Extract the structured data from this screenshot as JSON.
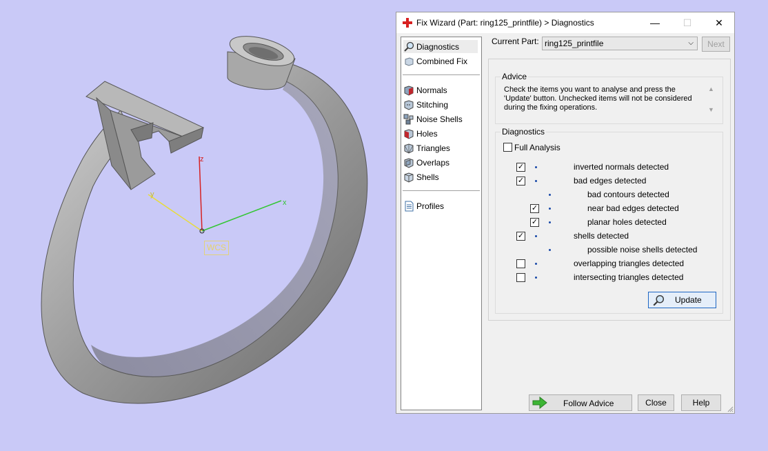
{
  "viewport": {
    "axes": {
      "z": "z",
      "y": "y",
      "x": "x",
      "wcs": "WCS"
    }
  },
  "dialog": {
    "title": "Fix Wizard (Part: ring125_printfile) > Diagnostics",
    "controls": {
      "minimize": "—",
      "maximize": "☐",
      "close": "✕"
    },
    "nav": {
      "top": [
        {
          "label": "Diagnostics",
          "icon": "magnifier-icon",
          "active": true
        },
        {
          "label": "Combined Fix",
          "icon": "cube-icon"
        }
      ],
      "middle": [
        {
          "label": "Normals",
          "icon": "normals-icon"
        },
        {
          "label": "Stitching",
          "icon": "stitching-icon"
        },
        {
          "label": "Noise Shells",
          "icon": "noise-shells-icon"
        },
        {
          "label": "Holes",
          "icon": "holes-icon"
        },
        {
          "label": "Triangles",
          "icon": "triangles-icon"
        },
        {
          "label": "Overlaps",
          "icon": "overlaps-icon"
        },
        {
          "label": "Shells",
          "icon": "shells-icon"
        }
      ],
      "bottom": [
        {
          "label": "Profiles",
          "icon": "document-icon"
        }
      ]
    },
    "current_part_label": "Current Part:",
    "current_part_value": "ring125_printfile",
    "next_label": "Next",
    "advice_title": "Advice",
    "advice_text": "Check the items you want to analyse and press the 'Update' button. Unchecked items will not be considered during the fixing operations.",
    "diagnostics_title": "Diagnostics",
    "full_analysis_label": "Full Analysis",
    "full_analysis_checked": false,
    "items": [
      {
        "label": "inverted normals detected",
        "has_checkbox": true,
        "checked": true,
        "level": 0
      },
      {
        "label": "bad edges detected",
        "has_checkbox": true,
        "checked": true,
        "level": 0
      },
      {
        "label": "bad contours detected",
        "has_checkbox": false,
        "checked": false,
        "level": 1
      },
      {
        "label": "near bad edges detected",
        "has_checkbox": true,
        "checked": true,
        "level": 1
      },
      {
        "label": "planar holes detected",
        "has_checkbox": true,
        "checked": true,
        "level": 1
      },
      {
        "label": "shells detected",
        "has_checkbox": true,
        "checked": true,
        "level": 0
      },
      {
        "label": "possible noise shells detected",
        "has_checkbox": false,
        "checked": false,
        "level": 1
      },
      {
        "label": "overlapping triangles detected",
        "has_checkbox": true,
        "checked": false,
        "level": 0
      },
      {
        "label": "intersecting triangles detected",
        "has_checkbox": true,
        "checked": false,
        "level": 0
      }
    ],
    "update_label": "Update",
    "follow_advice_label": "Follow Advice",
    "close_label": "Close",
    "help_label": "Help"
  }
}
